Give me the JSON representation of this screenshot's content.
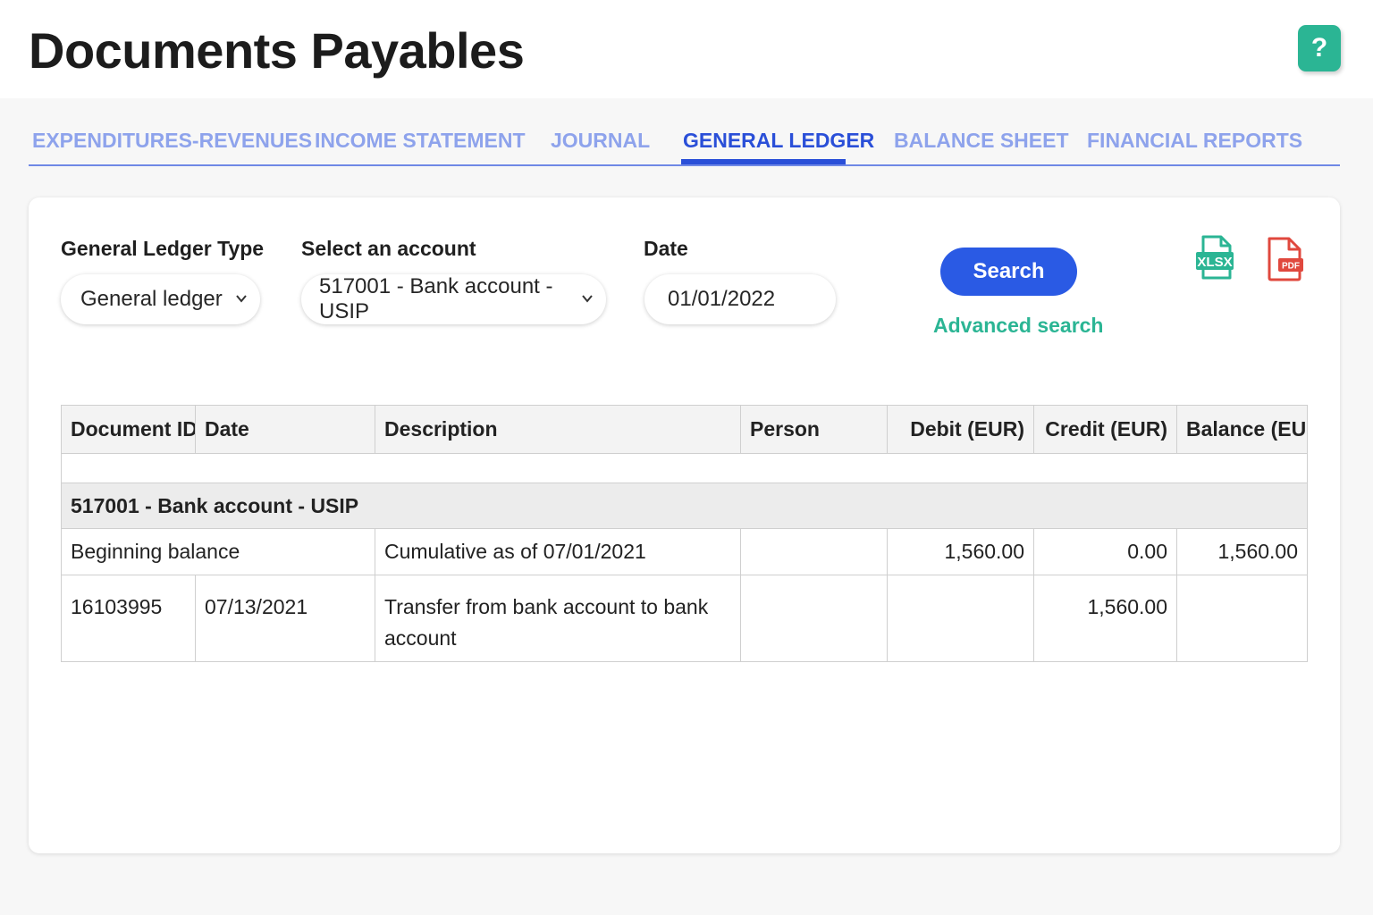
{
  "header": {
    "title": "Documents Payables",
    "help_label": "?"
  },
  "tabs": [
    {
      "label": "EXPENDITURES-REVENUES",
      "active": false
    },
    {
      "label": "INCOME STATEMENT",
      "active": false
    },
    {
      "label": "JOURNAL",
      "active": false
    },
    {
      "label": "GENERAL LEDGER",
      "active": true
    },
    {
      "label": "BALANCE SHEET",
      "active": false
    },
    {
      "label": "FINANCIAL REPORTS",
      "active": false
    }
  ],
  "filters": {
    "ledger_type": {
      "label": "General Ledger Type",
      "value": "General ledger"
    },
    "account": {
      "label": "Select an account",
      "value": "517001 - Bank account - USIP"
    },
    "date": {
      "label": "Date",
      "value": "01/01/2022"
    },
    "search_label": "Search",
    "advanced_search_label": "Advanced search"
  },
  "export": {
    "xlsx_label": "XLSX",
    "pdf_label": "PDF"
  },
  "table": {
    "columns": [
      "Document ID",
      "Date",
      "Description",
      "Person",
      "Debit (EUR)",
      "Credit (EUR)",
      "Balance (EUR)"
    ],
    "group_label": "517001  -  Bank account - USIP",
    "rows": [
      {
        "label": "Beginning balance",
        "description": "Cumulative as of 07/01/2021",
        "person": "",
        "debit": "1,560.00",
        "credit": "0.00",
        "balance": "1,560.00"
      },
      {
        "doc_id": "16103995",
        "date": "07/13/2021",
        "description": "Transfer from bank account to bank account",
        "person": "",
        "debit": "",
        "credit": "1,560.00",
        "balance": ""
      }
    ]
  },
  "colors": {
    "accent": "#2a5ae4",
    "tab_active": "#2a4fd8",
    "tab_inactive": "#8ea3ec",
    "success": "#2bb594",
    "pdf": "#e0483e"
  }
}
